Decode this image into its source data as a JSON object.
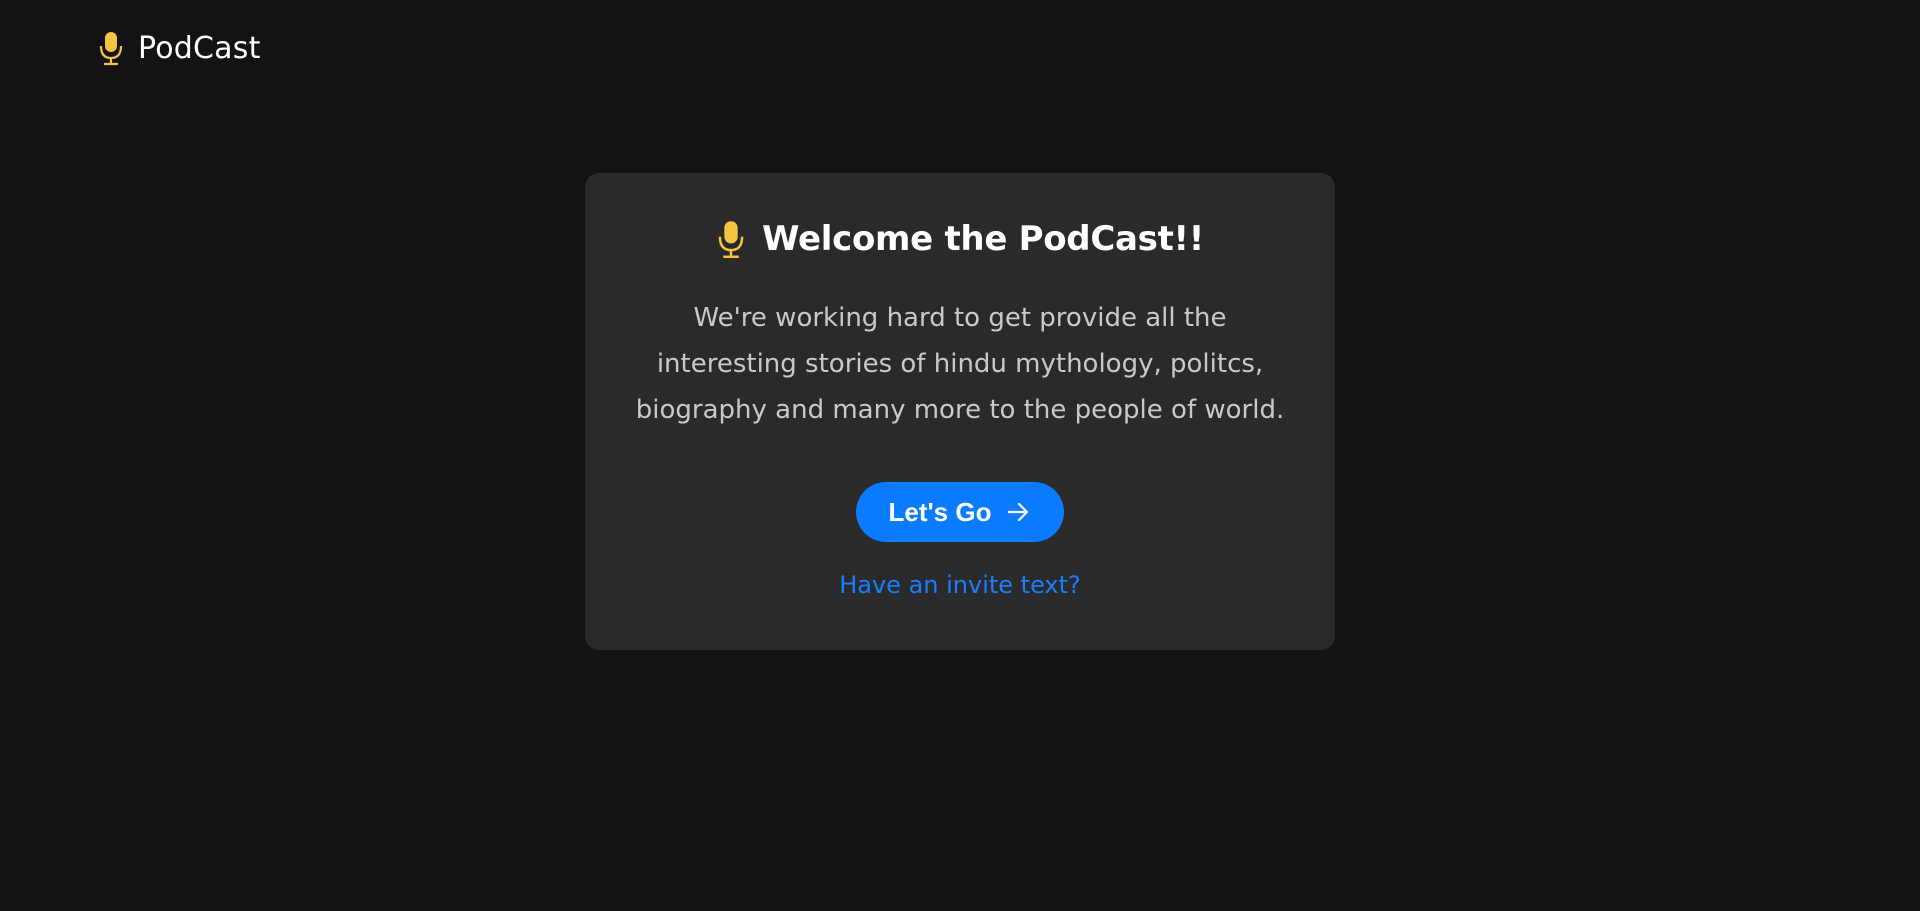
{
  "header": {
    "brand_name": "PodCast",
    "brand_icon": "microphone-icon"
  },
  "card": {
    "title": "Welcome the PodCast!!",
    "title_icon": "microphone-icon",
    "description": "We're working hard to get provide all the interesting stories of hindu mythology, politcs, biography and many more to the people of world.",
    "cta_label": "Let's Go",
    "cta_icon": "arrow-right-icon",
    "invite_link": "Have an invite text?"
  },
  "colors": {
    "background": "#131313",
    "card": "#2a2a2a",
    "accent_icon": "#f5c542",
    "button": "#0a7cff",
    "link": "#1a7fff"
  }
}
